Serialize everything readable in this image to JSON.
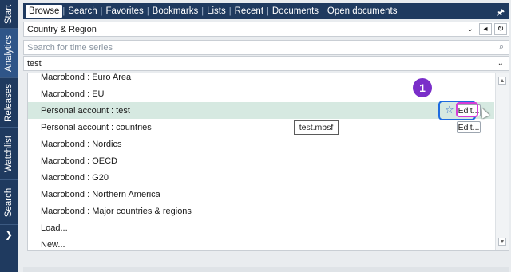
{
  "rail": {
    "tabs": [
      "Start",
      "Analytics",
      "Releases",
      "Watchlist",
      "Search"
    ]
  },
  "tabbar": {
    "tabs": [
      "Browse",
      "Search",
      "Favorites",
      "Bookmarks",
      "Lists",
      "Recent",
      "Documents",
      "Open documents"
    ],
    "pin_icon": "pin-icon"
  },
  "country_region": {
    "value": "Country & Region"
  },
  "search": {
    "placeholder": "Search for time series"
  },
  "filter": {
    "value": "test"
  },
  "list": {
    "items": [
      "Macrobond : Euro Area",
      "Macrobond : EU",
      "Personal account : test",
      "Personal account : countries",
      "Macrobond : Nordics",
      "Macrobond : OECD",
      "Macrobond : G20",
      "Macrobond : Northern America",
      "Macrobond : Major countries & regions",
      "Load...",
      "New..."
    ],
    "edit_label": "Edit...",
    "tooltip": "test.mbsf",
    "badge": "1"
  },
  "colors": {
    "accent": "#1f3a5f",
    "selection": "#d6e9e1",
    "badge": "#7a2ec9"
  }
}
